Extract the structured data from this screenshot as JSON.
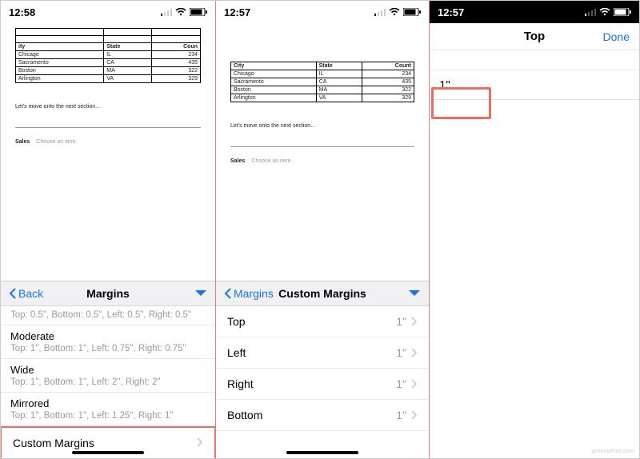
{
  "panes": {
    "p1": {
      "time": "12:58"
    },
    "p2": {
      "time": "12:57"
    },
    "p3": {
      "time": "12:57"
    }
  },
  "table": {
    "headers": {
      "city": "City",
      "state": "State",
      "count": "Count"
    },
    "headers_clipped": {
      "city": "ity",
      "count": "Coun"
    },
    "rows": [
      {
        "city": "Chicago",
        "state": "IL",
        "count": "234"
      },
      {
        "city": "Sacramento",
        "state": "CA",
        "count": "435"
      },
      {
        "city": "Boston",
        "state": "MA",
        "count": "322"
      },
      {
        "city": "Arlington",
        "state": "VA",
        "count": "329"
      }
    ]
  },
  "doc_text": {
    "section": "Let's move onto the next section...",
    "sales_label": "Sales",
    "choose": "Choose an item."
  },
  "margins_sheet": {
    "back": "Back",
    "title": "Margins",
    "clipped": {
      "sub": "Top: 0.5\", Bottom: 0.5\", Left: 0.5\", Right: 0.5\""
    },
    "options": [
      {
        "label": "Moderate",
        "sub": "Top: 1\", Bottom: 1\", Left: 0.75\", Right: 0.75\""
      },
      {
        "label": "Wide",
        "sub": "Top: 1\", Bottom: 1\", Left: 2\", Right: 2\""
      },
      {
        "label": "Mirrored",
        "sub": "Top: 1\", Bottom: 1\", Left: 1.25\", Right: 1\""
      }
    ],
    "custom": "Custom Margins"
  },
  "custom_sheet": {
    "back": "Margins",
    "title": "Custom Margins",
    "rows": [
      {
        "label": "Top",
        "value": "1\""
      },
      {
        "label": "Left",
        "value": "1\""
      },
      {
        "label": "Right",
        "value": "1\""
      },
      {
        "label": "Bottom",
        "value": "1\""
      }
    ]
  },
  "top_editor": {
    "title": "Top",
    "done": "Done",
    "value": "1\""
  },
  "watermark": "groovyPost.com"
}
